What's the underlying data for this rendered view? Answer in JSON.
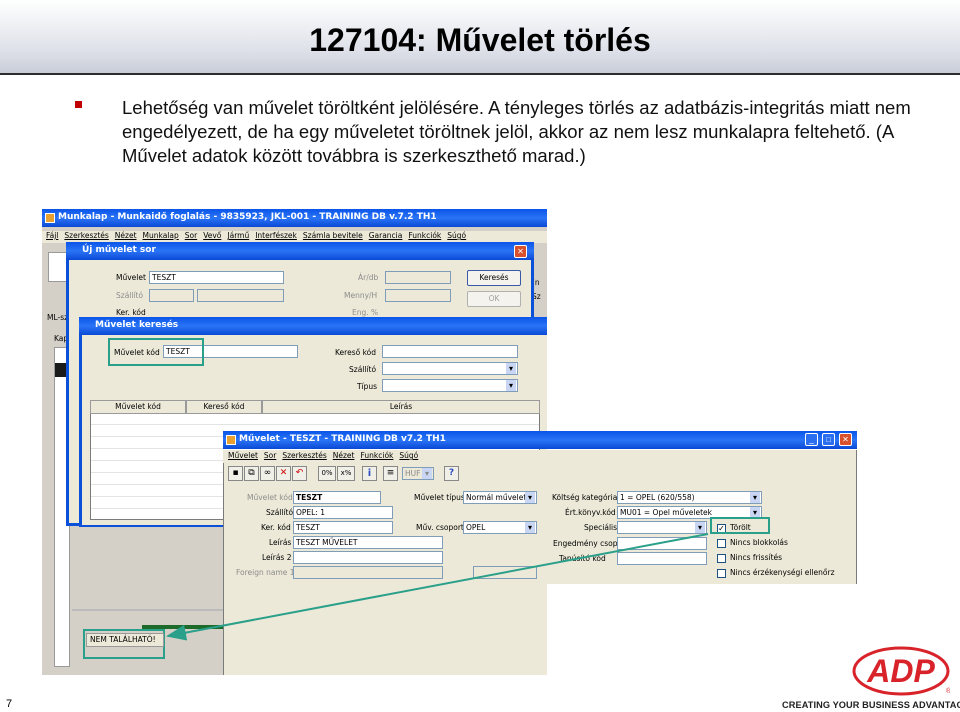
{
  "slide": {
    "title": "127104: Művelet törlés",
    "bullet": "Lehetőség van művelet töröltként jelölésére. A tényleges törlés az adatbázis-integritás miatt nem engedélyezett, de ha egy műveletet töröltnek jelöl, akkor az nem lesz munkalapra feltehető. (A Művelet adatok között továbbra is szerkeszthető marad.)",
    "number": "7",
    "tagline": "CREATING YOUR BUSINESS ADVANTAGE",
    "logo_text": "ADP",
    "logo_registered": "®",
    "brand_color": "#d8232a"
  },
  "bg_window": {
    "title": "Munkalap - Munkaidő foglalás - 9835923, JKL-001 - TRAINING DB v.7.2 TH1",
    "menu": [
      "Fájl",
      "Szerkesztés",
      "Nézet",
      "Munkalap",
      "Sor",
      "Vevő",
      "Jármű",
      "Interfészek",
      "Számla bevitele",
      "Garancia",
      "Funkciók",
      "Súgó"
    ],
    "label_ml": "ML-sz",
    "label_kap": "Kap",
    "status": "NEM TALÁLHATÓ!",
    "right_label_1": "(n",
    "right_label_2": "Sz"
  },
  "uj_muvelet": {
    "title": "Új művelet sor",
    "fields": {
      "muvelet_label": "Művelet",
      "muvelet_value": "TESZT",
      "szallito_label": "Szállító",
      "ker_kod_label": "Ker. kód",
      "ar_db_label": "Ár/db",
      "menny_h_label": "Menny/H",
      "eng_label": "Eng. %"
    },
    "buttons": {
      "search": "Keresés",
      "ok": "OK"
    }
  },
  "muvelet_kereses": {
    "title": "Művelet keresés",
    "fields": {
      "muvelet_kod_label": "Művelet kód",
      "muvelet_kod_value": "TESZT",
      "kereso_kod_label": "Kereső kód",
      "szallito_label": "Szállító",
      "tipus_label": "Típus"
    },
    "columns": [
      "Művelet kód",
      "Kereső kód",
      "Leírás"
    ]
  },
  "muvelet_window": {
    "title": "Művelet - TESZT - TRAINING DB v7.2 TH1",
    "menu": [
      "Művelet",
      "Sor",
      "Szerkesztés",
      "Nézet",
      "Funkciók",
      "Súgó"
    ],
    "toolbar": {
      "percent": "0%",
      "xpercent": "x%",
      "currency": "HUF",
      "help": "?",
      "info": "i"
    },
    "fields": {
      "muvelet_kod_label": "Művelet kód",
      "muvelet_kod_value": "TESZT",
      "szallito_label": "Szállító",
      "szallito_value": "OPEL: 1",
      "ker_kod_label": "Ker. kód",
      "ker_kod_value": "TESZT",
      "leiras_label": "Leírás",
      "leiras_value": "TESZT MŰVELET",
      "leiras2_label": "Leírás 2",
      "foreign_label": "Foreign name 1",
      "tipus_label": "Művelet típus",
      "tipus_value": "Normál művelet",
      "csop_label": "Műv. csoport",
      "csop_value": "OPEL",
      "kategoria_label": "Költség kategória",
      "kategoria_value": "1 = OPEL (620/558)",
      "konyv_label": "Ért.könyv.kód",
      "konyv_value": "MU01 = Opel műveletek",
      "specialis_label": "Speciális",
      "engedmeny_label": "Engedmény csop.",
      "tanusito_label": "Tanúsító kód"
    },
    "checkboxes": [
      {
        "label": "Törölt",
        "checked": true
      },
      {
        "label": "Nincs blokkolás",
        "checked": false
      },
      {
        "label": "Nincs frissítés",
        "checked": false
      },
      {
        "label": "Nincs érzékenységi ellenőrz",
        "checked": false
      }
    ]
  }
}
